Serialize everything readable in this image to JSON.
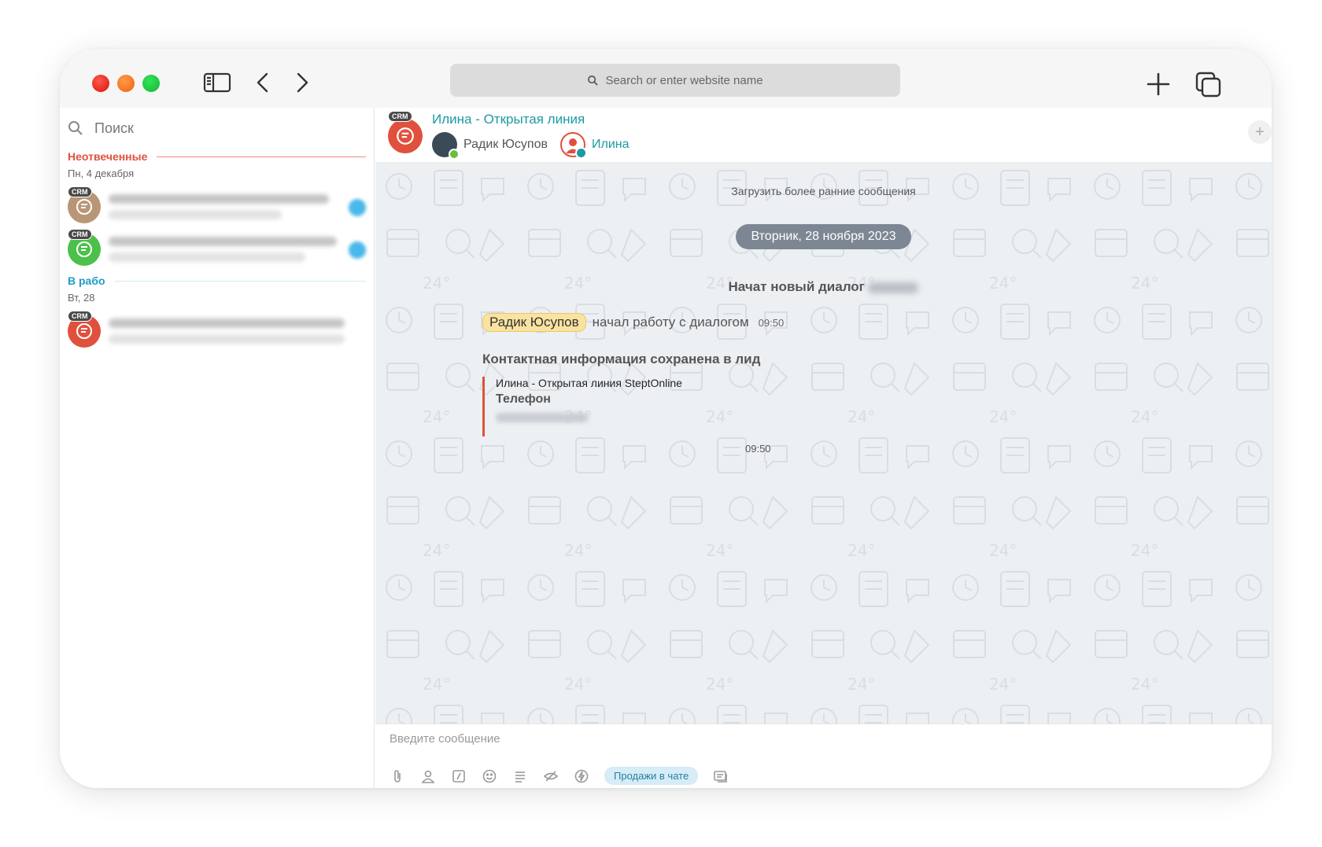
{
  "browser": {
    "address_placeholder": "Search or enter website name"
  },
  "sidebar": {
    "search_label": "Поиск",
    "sections": [
      {
        "title": "Неотвеченные",
        "date": "Пн, 4 декабря"
      },
      {
        "title": "В рабо",
        "date": "Вт, 28"
      }
    ],
    "crm_badge": "CRM"
  },
  "chat": {
    "crm_badge": "CRM",
    "title": "Илина - Открытая линия",
    "participants": [
      "Радик Юсупов",
      "Илина"
    ],
    "add_icon": "plus-icon",
    "load_earlier": "Загрузить более ранние сообщения",
    "date_separator": "Вторник, 28 ноября 2023",
    "new_dialog": "Начат новый диалог",
    "system_message": {
      "user": "Радик Юсупов",
      "text": "начал работу с диалогом",
      "time": "09:50"
    },
    "contact_card": {
      "title": "Контактная информация сохранена в лид",
      "line1": "Илина - Открытая линия SteptOnline",
      "line2": "Телефон",
      "time": "09:50"
    },
    "composer": {
      "placeholder": "Введите сообщение",
      "sales_button": "Продажи в чате"
    }
  },
  "colors": {
    "accent_teal": "#1c9aa3",
    "unanswered_red": "#e0513d",
    "work_blue": "#1f9dc6",
    "chat_bg": "#edf0f3"
  }
}
